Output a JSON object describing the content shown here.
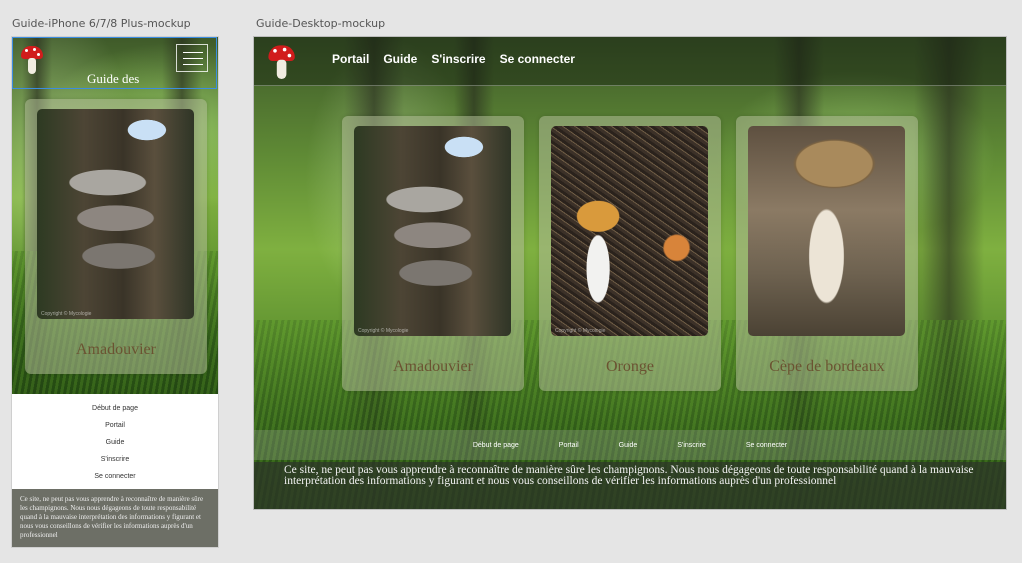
{
  "artboards": {
    "mobile_label": "Guide-iPhone 6/7/8 Plus-mockup",
    "desktop_label": "Guide-Desktop-mockup"
  },
  "mobile": {
    "title": "Guide des",
    "card": {
      "title": "Amadouvier",
      "copyright": "Copyright © Mycologie"
    },
    "nav": [
      "Début de page",
      "Portail",
      "Guide",
      "S'inscrire",
      "Se connecter"
    ],
    "footer": "Ce site, ne peut pas vous apprendre à reconnaître de manière sûre les champignons. Nous nous dégageons de toute responsabilité quand à la mauvaise interprétation des informations y figurant et nous vous conseillons de vérifier les informations auprès d'un professionnel"
  },
  "desktop": {
    "nav": [
      "Portail",
      "Guide",
      "S'inscrire",
      "Se connecter"
    ],
    "cards": [
      {
        "title": "Amadouvier",
        "copyright": "Copyright © Mycologie"
      },
      {
        "title": "Oronge",
        "copyright": "Copyright © Mycologie"
      },
      {
        "title": "Cèpe de bordeaux",
        "copyright": ""
      }
    ],
    "links": [
      "Début de page",
      "Portail",
      "Guide",
      "S'inscrire",
      "Se connecter"
    ],
    "footer": "Ce site, ne peut pas vous apprendre à reconnaître de manière sûre les champignons. Nous nous dégageons de toute responsabilité quand à la mauvaise interprétation des informations y figurant et nous vous conseillons de vérifier les informations auprès d'un professionnel"
  },
  "icons": {
    "logo": "mushroom-logo-icon",
    "menu": "hamburger-menu-icon"
  },
  "colors": {
    "accent_selection": "#3c8de0",
    "mushroom_cap": "#d11c1c",
    "card_title": "#6b5332"
  }
}
